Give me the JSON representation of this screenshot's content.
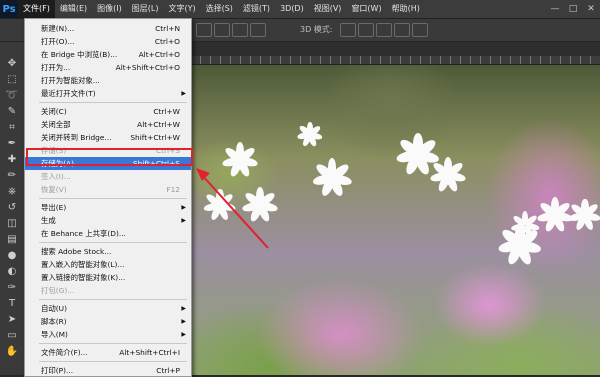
{
  "app": {
    "logo": "Ps"
  },
  "menubar": {
    "items": [
      "文件(F)",
      "编辑(E)",
      "图像(I)",
      "图层(L)",
      "文字(Y)",
      "选择(S)",
      "滤镜(T)",
      "3D(D)",
      "视图(V)",
      "窗口(W)",
      "帮助(H)"
    ]
  },
  "window_controls": [
    "—",
    "□",
    "✕"
  ],
  "optionsbar": {
    "mode_label": "3D 模式:"
  },
  "file_menu": {
    "items": [
      {
        "label": "新建(N)...",
        "shortcut": "Ctrl+N"
      },
      {
        "label": "打开(O)...",
        "shortcut": "Ctrl+O"
      },
      {
        "label": "在 Bridge 中浏览(B)...",
        "shortcut": "Alt+Ctrl+O"
      },
      {
        "label": "打开为...",
        "shortcut": "Alt+Shift+Ctrl+O"
      },
      {
        "label": "打开为智能对象..."
      },
      {
        "label": "最近打开文件(T)",
        "submenu": true
      },
      {
        "separator": true
      },
      {
        "label": "关闭(C)",
        "shortcut": "Ctrl+W"
      },
      {
        "label": "关闭全部",
        "shortcut": "Alt+Ctrl+W"
      },
      {
        "label": "关闭并转到 Bridge...",
        "shortcut": "Shift+Ctrl+W"
      },
      {
        "label": "存储(S)",
        "shortcut": "Ctrl+S",
        "disabled": true
      },
      {
        "label": "存储为(A)...",
        "shortcut": "Shift+Ctrl+S",
        "highlighted": true
      },
      {
        "label": "签入(I)...",
        "disabled": true
      },
      {
        "label": "恢复(V)",
        "shortcut": "F12",
        "disabled": true
      },
      {
        "separator": true
      },
      {
        "label": "导出(E)",
        "submenu": true
      },
      {
        "label": "生成",
        "submenu": true
      },
      {
        "label": "在 Behance 上共享(D)..."
      },
      {
        "separator": true
      },
      {
        "label": "搜索 Adobe Stock..."
      },
      {
        "label": "置入嵌入的智能对象(L)..."
      },
      {
        "label": "置入链接的智能对象(K)..."
      },
      {
        "label": "打包(G)...",
        "disabled": true
      },
      {
        "separator": true
      },
      {
        "label": "自动(U)",
        "submenu": true
      },
      {
        "label": "脚本(R)",
        "submenu": true
      },
      {
        "label": "导入(M)",
        "submenu": true
      },
      {
        "separator": true
      },
      {
        "label": "文件简介(F)...",
        "shortcut": "Alt+Shift+Ctrl+I"
      },
      {
        "separator": true
      },
      {
        "label": "打印(P)...",
        "shortcut": "Ctrl+P"
      }
    ]
  },
  "tools": [
    "move-tool-icon",
    "marquee-tool-icon",
    "lasso-tool-icon",
    "quick-select-tool-icon",
    "crop-tool-icon",
    "eyedropper-tool-icon",
    "healing-tool-icon",
    "brush-tool-icon",
    "stamp-tool-icon",
    "history-brush-icon",
    "eraser-tool-icon",
    "gradient-tool-icon",
    "blur-tool-icon",
    "dodge-tool-icon",
    "pen-tool-icon",
    "type-tool-icon",
    "path-select-tool-icon",
    "shape-tool-icon",
    "hand-tool-icon"
  ],
  "colors": {
    "highlight": "#3a78d8",
    "annotation_red": "#e0222c",
    "menubar_bg": "#3c3c3c"
  }
}
